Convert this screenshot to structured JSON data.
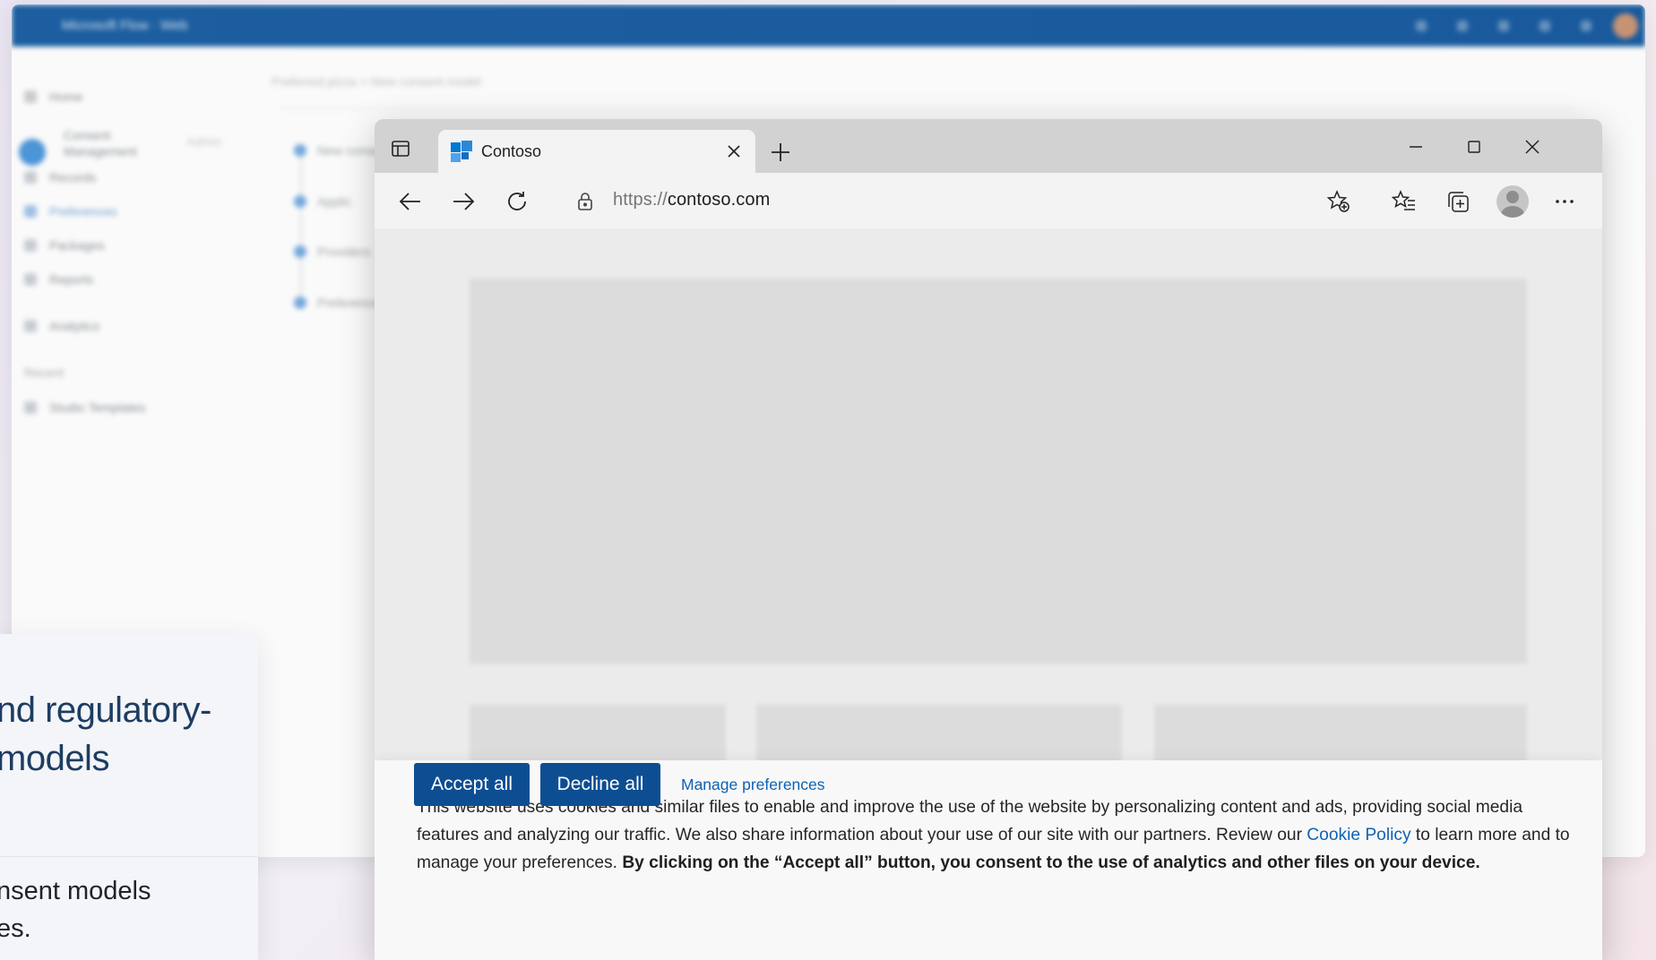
{
  "background_app": {
    "title": "Microsoft Flow · Web",
    "breadcrumb": "Preferred pizza  >  New consent model",
    "sidebar_items": [
      "Home",
      "Consent Management",
      "Records",
      "Preferences",
      "Packages",
      "Reports",
      "Analytics",
      "Recent",
      "Studio Templates"
    ],
    "list_items": [
      "New consent",
      "Applic",
      "Providers",
      "Preference"
    ],
    "badge": "Admin"
  },
  "side_card": {
    "heading": "nd regulatory-\nmodels",
    "subtext": "nsent models\nes."
  },
  "browser": {
    "tab_title": "Contoso",
    "url_scheme": "https://",
    "url_host": "contoso.com",
    "favicon_colors": [
      "#0078d4",
      "#4ca3ee",
      "#106ebe",
      "#2b88d8"
    ],
    "icons": {
      "tab_actions": "tab-actions-icon",
      "tab_close": "close-icon",
      "new_tab": "plus-icon",
      "minimize": "minimize-icon",
      "maximize": "maximize-icon",
      "close": "close-icon",
      "back": "arrow-left-icon",
      "forward": "arrow-right-icon",
      "refresh": "refresh-icon",
      "lock": "lock-icon",
      "add_favorite": "star-add-icon",
      "favorites": "favorites-icon",
      "collections": "collections-icon",
      "profile": "profile-icon",
      "more": "more-icon"
    }
  },
  "cookie_banner": {
    "text_part1": "This website uses cookies and similar files to enable and improve the use of the website by personalizing content and ads, providing social media features and analyzing our traffic. We also share information about your use of our site with our partners. Review our ",
    "cookie_policy_link": "Cookie Policy",
    "text_part2": " to learn more and to manage your preferences. ",
    "bold_text": "By clicking on the “Accept all” button, you consent to the use of analytics and other files on your device.",
    "accept_label": "Accept all",
    "decline_label": "Decline all",
    "manage_label": "Manage preferences",
    "button_color": "#0d4e93",
    "link_color": "#0f62b5"
  }
}
